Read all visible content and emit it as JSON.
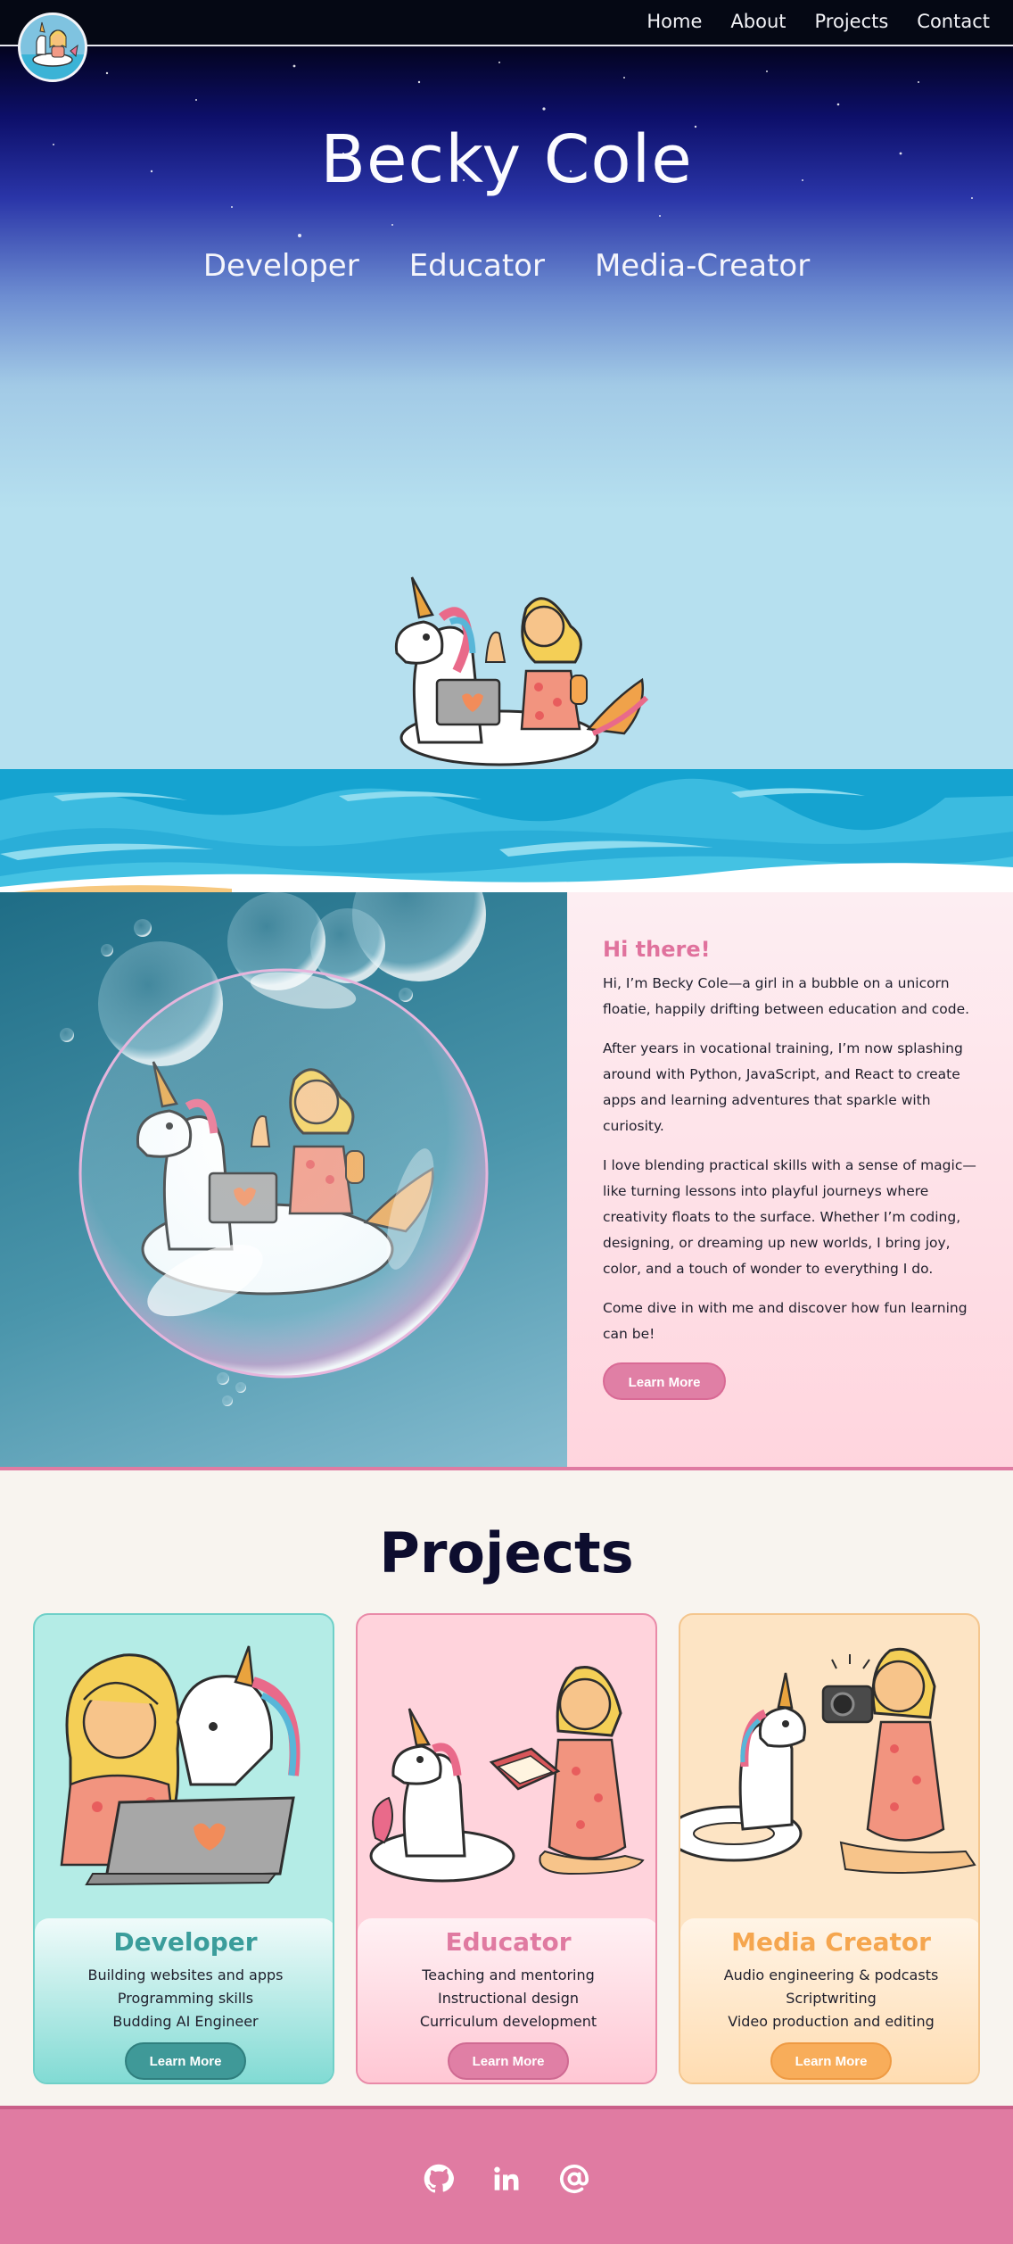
{
  "nav": {
    "links": [
      "Home",
      "About",
      "Projects",
      "Contact"
    ]
  },
  "hero": {
    "title": "Becky Cole",
    "roles": [
      "Developer",
      "Educator",
      "Media-Creator"
    ]
  },
  "about": {
    "heading": "Hi there!",
    "paragraphs": [
      "Hi, I’m Becky Cole—a girl in a bubble on a unicorn floatie, happily drifting between education and code.",
      "After years in vocational training, I’m now splashing around with Python, JavaScript, and React to create apps and learning adventures that sparkle with curiosity.",
      "I love blending practical skills with a sense of magic—like turning lessons into playful journeys where creativity floats to the surface. Whether I’m coding, designing, or dreaming up new worlds, I bring joy, color, and a touch of wonder to everything I do.",
      "Come dive in with me and discover how fun learning can be!"
    ],
    "button": "Learn More"
  },
  "projects": {
    "title": "Projects",
    "cards": [
      {
        "title": "Developer",
        "lines": [
          "Building websites and apps",
          "Programming skills",
          "Budding AI Engineer"
        ],
        "button": "Learn More"
      },
      {
        "title": "Educator",
        "lines": [
          "Teaching and mentoring",
          "Instructional design",
          "Curriculum development"
        ],
        "button": "Learn More"
      },
      {
        "title": "Media Creator",
        "lines": [
          "Audio engineering & podcasts",
          "Scriptwriting",
          "Video production and editing"
        ],
        "button": "Learn More"
      }
    ]
  },
  "footer": {
    "icons": [
      "github-icon",
      "linkedin-icon",
      "email-at-icon"
    ]
  },
  "colors": {
    "pink_accent": "#e07ba2",
    "teal_accent": "#3f9998",
    "orange_accent": "#f8ad5a",
    "navy_text": "#0d0d2e"
  }
}
